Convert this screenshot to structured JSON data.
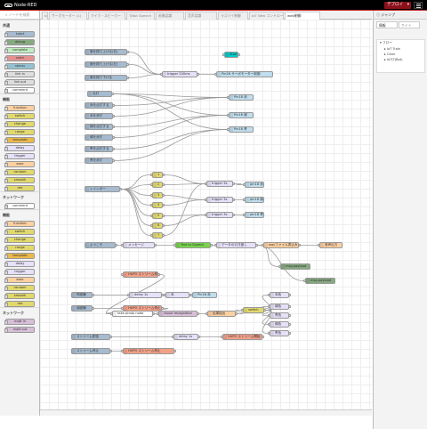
{
  "header": {
    "app_title": "Node-RED",
    "deploy_label": "デプロイ"
  },
  "palette": {
    "search_placeholder": "ノードを検索",
    "sections": [
      {
        "title": "共通",
        "nodes": [
          {
            "label": "inject",
            "color": "#a6bbcf"
          },
          {
            "label": "debug",
            "color": "#87a980"
          },
          {
            "label": "complete",
            "color": "#c0edc0"
          },
          {
            "label": "catch",
            "color": "#e49191"
          },
          {
            "label": "status",
            "color": "#94c1d0"
          },
          {
            "label": "link in",
            "color": "#dddddd"
          },
          {
            "label": "link out",
            "color": "#dddddd"
          },
          {
            "label": "comment",
            "color": "#ffffff"
          }
        ]
      },
      {
        "title": "機能",
        "nodes": [
          {
            "label": "function",
            "color": "#fdd0a2"
          },
          {
            "label": "switch",
            "color": "#e2d96e"
          },
          {
            "label": "change",
            "color": "#e2d96e"
          },
          {
            "label": "range",
            "color": "#e2d96e"
          },
          {
            "label": "template",
            "color": "#ebb84b"
          },
          {
            "label": "delay",
            "color": "#e6e0f8"
          },
          {
            "label": "trigger",
            "color": "#e6e0f8"
          },
          {
            "label": "exec",
            "color": "#fdd0a2"
          },
          {
            "label": "random",
            "color": "#e2d96e"
          },
          {
            "label": "smooth",
            "color": "#e2d96e"
          },
          {
            "label": "rbe",
            "color": "#e2d96e"
          }
        ]
      },
      {
        "title": "ネットワーク",
        "nodes": [
          {
            "label": "comment",
            "color": "#ffffff"
          }
        ]
      },
      {
        "title": "機能",
        "nodes": [
          {
            "label": "function",
            "color": "#fdd0a2"
          },
          {
            "label": "switch",
            "color": "#e2d96e"
          },
          {
            "label": "change",
            "color": "#e2d96e"
          },
          {
            "label": "range",
            "color": "#e2d96e"
          },
          {
            "label": "template",
            "color": "#ebb84b"
          },
          {
            "label": "delay",
            "color": "#e6e0f8"
          },
          {
            "label": "trigger",
            "color": "#e6e0f8"
          },
          {
            "label": "exec",
            "color": "#fdd0a2"
          },
          {
            "label": "random",
            "color": "#e2d96e"
          },
          {
            "label": "smooth",
            "color": "#e2d96e"
          },
          {
            "label": "rbe",
            "color": "#e2d96e"
          }
        ]
      },
      {
        "title": "ネットワーク",
        "nodes": [
          {
            "label": "mqtt in",
            "color": "#d8bfd8"
          },
          {
            "label": "mqtt out",
            "color": "#d8bfd8"
          }
        ]
      }
    ]
  },
  "tabs": [
    {
      "label": "IoT"
    },
    {
      "label": "サーボモーター (1)"
    },
    {
      "label": "マイク・スピーカー"
    },
    {
      "label": "TJBot Speech"
    },
    {
      "label": "画像認識"
    },
    {
      "label": "音声認識"
    },
    {
      "label": "ラズパイ制御"
    },
    {
      "label": "IoT Web コントローラー"
    },
    {
      "label": "web制御",
      "active": true
    }
  ],
  "flow_nodes": [
    {
      "label": "腕を振り上げる(右)",
      "color": "#a6bbcf"
    },
    {
      "label": "腕を振り上げる(左)",
      "color": "#a6bbcf"
    },
    {
      "label": "腕を振り下げる",
      "color": "#a6bbcf"
    },
    {
      "label": "trigger 200ms",
      "color": "#e6e0f8"
    },
    {
      "label": "Pin26 サーボモーター制御",
      "color": "#c0deed"
    },
    {
      "label": "Start",
      "color": "#00cccc"
    },
    {
      "label": "点灯",
      "color": "#a6bbcf"
    },
    {
      "label": "赤を点灯する",
      "color": "#a6bbcf"
    },
    {
      "label": "赤を消す",
      "color": "#a6bbcf"
    },
    {
      "label": "緑を点灯する",
      "color": "#a6bbcf"
    },
    {
      "label": "緑を消す",
      "color": "#a6bbcf"
    },
    {
      "label": "青を点灯する",
      "color": "#a6bbcf"
    },
    {
      "label": "青を消す",
      "color": "#a6bbcf"
    },
    {
      "label": "Pin18 赤",
      "color": "#c0deed"
    },
    {
      "label": "Pin16 緑",
      "color": "#c0deed"
    },
    {
      "label": "Pin18 青",
      "color": "#c0deed"
    },
    {
      "label": "レインボー",
      "color": "#a6bbcf"
    },
    {
      "label": "1",
      "color": "#e2d96e"
    },
    {
      "label": "2",
      "color": "#e2d96e"
    },
    {
      "label": "3",
      "color": "#e2d96e"
    },
    {
      "label": "4",
      "color": "#e2d96e"
    },
    {
      "label": "5",
      "color": "#e2d96e"
    },
    {
      "label": "6",
      "color": "#e2d96e"
    },
    {
      "label": "7",
      "color": "#e2d96e"
    },
    {
      "label": "trigger 3s",
      "color": "#e6e0f8"
    },
    {
      "label": "trigger 3s",
      "color": "#e6e0f8"
    },
    {
      "label": "trigger 3s",
      "color": "#e6e0f8"
    },
    {
      "label": "pin18 赤色",
      "color": "#c0deed"
    },
    {
      "label": "pin16 緑",
      "color": "#c0deed"
    },
    {
      "label": "pin18 青",
      "color": "#c0deed"
    },
    {
      "label": "ようこそ",
      "color": "#a6bbcf"
    },
    {
      "label": "メッセージ",
      "color": "#e6e0f8"
    },
    {
      "label": "Text to Speech",
      "color": "#77d44b"
    },
    {
      "label": "データの引き渡し",
      "color": "#e6e0f8"
    },
    {
      "label": "wavファイル書込み",
      "color": "#fdd0a2"
    },
    {
      "label": "音声出力",
      "color": "#fdd0a2"
    },
    {
      "label": "msg.payload",
      "color": "#87a980"
    },
    {
      "label": "msg.payload",
      "color": "#87a980"
    },
    {
      "label": "HUPO ストリーム停止",
      "color": "#f2a188"
    },
    {
      "label": "物認識",
      "color": "#a6bbcf"
    },
    {
      "label": "delay 1s",
      "color": "#e6e0f8"
    },
    {
      "label": "赤",
      "color": "#e6e0f8"
    },
    {
      "label": "Pin18 赤",
      "color": "#c0deed"
    },
    {
      "label": "顔認識",
      "color": "#a6bbcf"
    },
    {
      "label": "HUPO ストリーム停止",
      "color": "#f2a188"
    },
    {
      "label": "take photo node",
      "color": "#ffffff"
    },
    {
      "label": "visual recognition",
      "color": "#d8bfd8"
    },
    {
      "label": "結果抽出",
      "color": "#fdd0a2"
    },
    {
      "label": "switch",
      "color": "#e2d96e"
    },
    {
      "label": "赤色",
      "color": "#e6e0f8"
    },
    {
      "label": "緑色",
      "color": "#e6e0f8"
    },
    {
      "label": "青色",
      "color": "#e6e0f8"
    },
    {
      "label": "緑色",
      "color": "#e6e0f8"
    },
    {
      "label": "青色",
      "color": "#e6e0f8"
    },
    {
      "label": "ストリーム配信",
      "color": "#a6bbcf"
    },
    {
      "label": "delay 1s",
      "color": "#e6e0f8"
    },
    {
      "label": "HUPO ストリーム開始",
      "color": "#f2a188"
    },
    {
      "label": "ストリーム停止",
      "color": "#a6bbcf"
    },
    {
      "label": "HUPO ストリーム停止",
      "color": "#f2a188"
    }
  ],
  "sidebar": {
    "header_title": "ジャンプ",
    "tab_info": "情報",
    "tab_site": "サイト",
    "flows_heading": "フロー",
    "tree_items": [
      {
        "label": "IoT Train"
      },
      {
        "label": "Clear"
      },
      {
        "label": "IoT(TJBot)"
      }
    ]
  }
}
